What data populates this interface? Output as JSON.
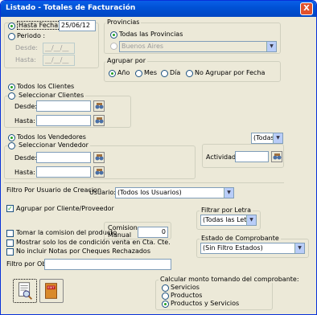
{
  "window": {
    "title": "Listado - Totales de Facturación",
    "close": "X"
  },
  "fecha": {
    "hasta_fecha_label": "Hasta Fecha :",
    "hasta_fecha_value": "25/06/12",
    "periodo_label": "Periodo :",
    "desde_label": "Desde:",
    "desde_value": "__/__/__",
    "hasta_label": "Hasta:",
    "hasta_value": "__/__/__"
  },
  "provincias": {
    "group_label": "Provincias",
    "todas_label": "Todas las Provincias",
    "selected_value": "Buenos Aires"
  },
  "agrupar": {
    "group_label": "Agrupar por",
    "options": [
      "Año",
      "Mes",
      "Día",
      "No Agrupar por Fecha"
    ]
  },
  "clientes": {
    "todos_label": "Todos los Clientes",
    "seleccionar_label": "Seleccionar Clientes",
    "desde_label": "Desde:",
    "hasta_label": "Hasta:"
  },
  "vendedores": {
    "todos_label": "Todos los Vendedores",
    "seleccionar_label": "Seleccionar Vendedor",
    "desde_label": "Desde:",
    "hasta_label": "Hasta:",
    "combo_value": "(Todas lá"
  },
  "actividad": {
    "label": "Actividad"
  },
  "usuario": {
    "filtro_label": "Filtro Por Usuario de Creacion",
    "usuario_label": "Usuario:",
    "usuario_value": "(Todos los Usuarios)"
  },
  "agrupar_cliente": {
    "label": "Agrupar por Cliente/Proveedor"
  },
  "letra": {
    "group_label": "Filtrar por Letra",
    "value": "(Todas las Letras"
  },
  "comision": {
    "tomar_label": "Tomar la comision del producto",
    "manual_label_1": "Comision",
    "manual_label_2": "Manual",
    "manual_value": "0"
  },
  "condicion": {
    "label": "Mostrar solo los de condición venta en Cta. Cte."
  },
  "notas": {
    "label": "No incluir Notas por Cheques Rechazados"
  },
  "estado": {
    "group_label": "Estado de Comprobante",
    "value": "(Sin Filtro Estados)"
  },
  "obs": {
    "label": "Filtro por Obs:"
  },
  "monto": {
    "group_label": "Calcular monto tomando del comprobante:",
    "options": [
      "Servicios",
      "Productos",
      "Productos y Servicios"
    ]
  },
  "buttons": {
    "print_icon": "print-preview-icon",
    "exit_icon": "exit-icon",
    "exit_text": "EXIT"
  },
  "colors": {
    "titlebar": "#0052d6",
    "window_bg": "#ece9d8",
    "radio_dot": "#21a121"
  }
}
